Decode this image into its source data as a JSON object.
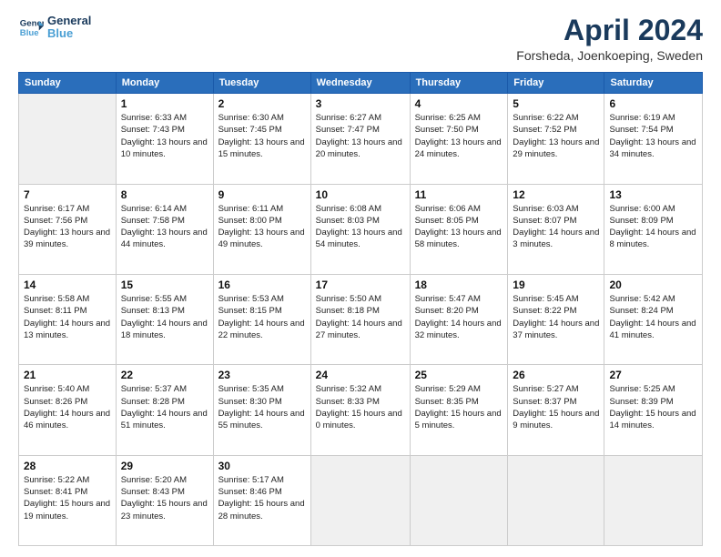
{
  "header": {
    "logo_line1": "General",
    "logo_line2": "Blue",
    "title": "April 2024",
    "subtitle": "Forsheda, Joenkoeping, Sweden"
  },
  "columns": [
    "Sunday",
    "Monday",
    "Tuesday",
    "Wednesday",
    "Thursday",
    "Friday",
    "Saturday"
  ],
  "weeks": [
    [
      {
        "day": "",
        "empty": true
      },
      {
        "day": "1",
        "sunrise": "6:33 AM",
        "sunset": "7:43 PM",
        "daylight": "13 hours and 10 minutes."
      },
      {
        "day": "2",
        "sunrise": "6:30 AM",
        "sunset": "7:45 PM",
        "daylight": "13 hours and 15 minutes."
      },
      {
        "day": "3",
        "sunrise": "6:27 AM",
        "sunset": "7:47 PM",
        "daylight": "13 hours and 20 minutes."
      },
      {
        "day": "4",
        "sunrise": "6:25 AM",
        "sunset": "7:50 PM",
        "daylight": "13 hours and 24 minutes."
      },
      {
        "day": "5",
        "sunrise": "6:22 AM",
        "sunset": "7:52 PM",
        "daylight": "13 hours and 29 minutes."
      },
      {
        "day": "6",
        "sunrise": "6:19 AM",
        "sunset": "7:54 PM",
        "daylight": "13 hours and 34 minutes."
      }
    ],
    [
      {
        "day": "7",
        "sunrise": "6:17 AM",
        "sunset": "7:56 PM",
        "daylight": "13 hours and 39 minutes."
      },
      {
        "day": "8",
        "sunrise": "6:14 AM",
        "sunset": "7:58 PM",
        "daylight": "13 hours and 44 minutes."
      },
      {
        "day": "9",
        "sunrise": "6:11 AM",
        "sunset": "8:00 PM",
        "daylight": "13 hours and 49 minutes."
      },
      {
        "day": "10",
        "sunrise": "6:08 AM",
        "sunset": "8:03 PM",
        "daylight": "13 hours and 54 minutes."
      },
      {
        "day": "11",
        "sunrise": "6:06 AM",
        "sunset": "8:05 PM",
        "daylight": "13 hours and 58 minutes."
      },
      {
        "day": "12",
        "sunrise": "6:03 AM",
        "sunset": "8:07 PM",
        "daylight": "14 hours and 3 minutes."
      },
      {
        "day": "13",
        "sunrise": "6:00 AM",
        "sunset": "8:09 PM",
        "daylight": "14 hours and 8 minutes."
      }
    ],
    [
      {
        "day": "14",
        "sunrise": "5:58 AM",
        "sunset": "8:11 PM",
        "daylight": "14 hours and 13 minutes."
      },
      {
        "day": "15",
        "sunrise": "5:55 AM",
        "sunset": "8:13 PM",
        "daylight": "14 hours and 18 minutes."
      },
      {
        "day": "16",
        "sunrise": "5:53 AM",
        "sunset": "8:15 PM",
        "daylight": "14 hours and 22 minutes."
      },
      {
        "day": "17",
        "sunrise": "5:50 AM",
        "sunset": "8:18 PM",
        "daylight": "14 hours and 27 minutes."
      },
      {
        "day": "18",
        "sunrise": "5:47 AM",
        "sunset": "8:20 PM",
        "daylight": "14 hours and 32 minutes."
      },
      {
        "day": "19",
        "sunrise": "5:45 AM",
        "sunset": "8:22 PM",
        "daylight": "14 hours and 37 minutes."
      },
      {
        "day": "20",
        "sunrise": "5:42 AM",
        "sunset": "8:24 PM",
        "daylight": "14 hours and 41 minutes."
      }
    ],
    [
      {
        "day": "21",
        "sunrise": "5:40 AM",
        "sunset": "8:26 PM",
        "daylight": "14 hours and 46 minutes."
      },
      {
        "day": "22",
        "sunrise": "5:37 AM",
        "sunset": "8:28 PM",
        "daylight": "14 hours and 51 minutes."
      },
      {
        "day": "23",
        "sunrise": "5:35 AM",
        "sunset": "8:30 PM",
        "daylight": "14 hours and 55 minutes."
      },
      {
        "day": "24",
        "sunrise": "5:32 AM",
        "sunset": "8:33 PM",
        "daylight": "15 hours and 0 minutes."
      },
      {
        "day": "25",
        "sunrise": "5:29 AM",
        "sunset": "8:35 PM",
        "daylight": "15 hours and 5 minutes."
      },
      {
        "day": "26",
        "sunrise": "5:27 AM",
        "sunset": "8:37 PM",
        "daylight": "15 hours and 9 minutes."
      },
      {
        "day": "27",
        "sunrise": "5:25 AM",
        "sunset": "8:39 PM",
        "daylight": "15 hours and 14 minutes."
      }
    ],
    [
      {
        "day": "28",
        "sunrise": "5:22 AM",
        "sunset": "8:41 PM",
        "daylight": "15 hours and 19 minutes."
      },
      {
        "day": "29",
        "sunrise": "5:20 AM",
        "sunset": "8:43 PM",
        "daylight": "15 hours and 23 minutes."
      },
      {
        "day": "30",
        "sunrise": "5:17 AM",
        "sunset": "8:46 PM",
        "daylight": "15 hours and 28 minutes."
      },
      {
        "day": "",
        "empty": true
      },
      {
        "day": "",
        "empty": true
      },
      {
        "day": "",
        "empty": true
      },
      {
        "day": "",
        "empty": true
      }
    ]
  ],
  "labels": {
    "sunrise": "Sunrise:",
    "sunset": "Sunset:",
    "daylight": "Daylight:"
  }
}
